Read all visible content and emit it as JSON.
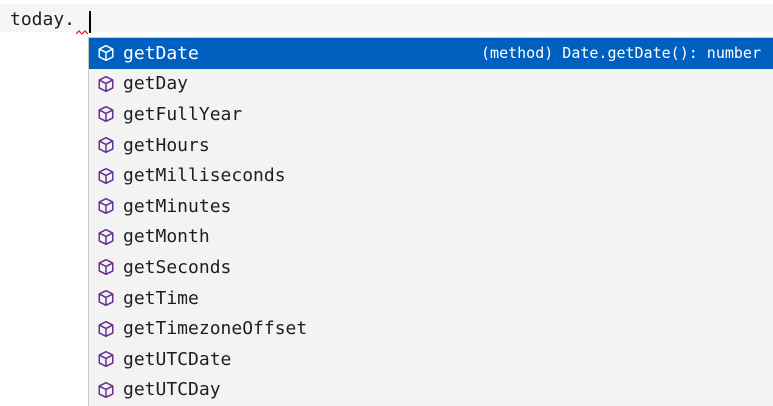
{
  "editor": {
    "code_text": "today.",
    "method_icon_color": "#652d90",
    "selected_bg": "#0060c0"
  },
  "suggestions": {
    "selected_detail": "(method) Date.getDate(): number",
    "items": [
      {
        "label": "getDate",
        "icon": "method-cube-icon"
      },
      {
        "label": "getDay",
        "icon": "method-cube-icon"
      },
      {
        "label": "getFullYear",
        "icon": "method-cube-icon"
      },
      {
        "label": "getHours",
        "icon": "method-cube-icon"
      },
      {
        "label": "getMilliseconds",
        "icon": "method-cube-icon"
      },
      {
        "label": "getMinutes",
        "icon": "method-cube-icon"
      },
      {
        "label": "getMonth",
        "icon": "method-cube-icon"
      },
      {
        "label": "getSeconds",
        "icon": "method-cube-icon"
      },
      {
        "label": "getTime",
        "icon": "method-cube-icon"
      },
      {
        "label": "getTimezoneOffset",
        "icon": "method-cube-icon"
      },
      {
        "label": "getUTCDate",
        "icon": "method-cube-icon"
      },
      {
        "label": "getUTCDay",
        "icon": "method-cube-icon"
      }
    ]
  }
}
